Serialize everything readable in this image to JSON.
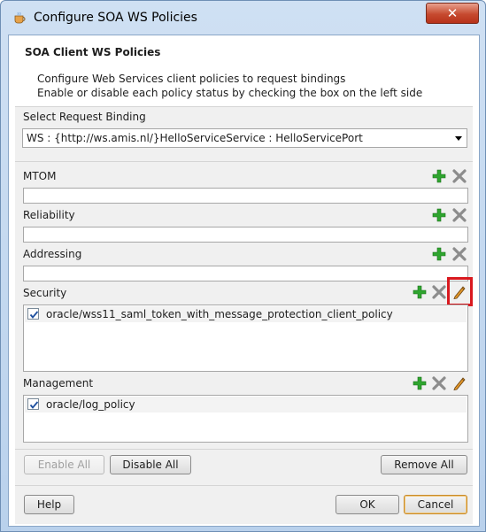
{
  "window": {
    "title": "Configure SOA WS Policies",
    "close_glyph": "✕"
  },
  "header": {
    "title": "SOA Client WS Policies",
    "line1": "Configure Web Services client policies to request bindings",
    "line2": "Enable or disable each policy status by checking the box on the left side"
  },
  "binding": {
    "label": "Select Request Binding",
    "selected": "WS : {http://ws.amis.nl/}HelloServiceService : HelloServicePort"
  },
  "sections": {
    "mtom": {
      "label": "MTOM"
    },
    "reliability": {
      "label": "Reliability"
    },
    "addressing": {
      "label": "Addressing"
    },
    "security": {
      "label": "Security",
      "policies": [
        {
          "checked": true,
          "name": "oracle/wss11_saml_token_with_message_protection_client_policy"
        }
      ]
    },
    "management": {
      "label": "Management",
      "policies": [
        {
          "checked": true,
          "name": "oracle/log_policy"
        }
      ]
    }
  },
  "buttons": {
    "enable_all": "Enable All",
    "disable_all": "Disable All",
    "remove_all": "Remove All",
    "help": "Help",
    "ok": "OK",
    "cancel": "Cancel"
  },
  "icons": {
    "add": "plus-icon",
    "remove": "x-icon",
    "edit": "pencil-icon"
  },
  "colors": {
    "add_green": "#2fa52f",
    "remove_gray": "#8c8c8c",
    "edit_orange": "#d9861c",
    "highlight_red": "#d9191f",
    "titlebar_blue": "#c3d8f0",
    "close_red": "#c64a2f"
  }
}
